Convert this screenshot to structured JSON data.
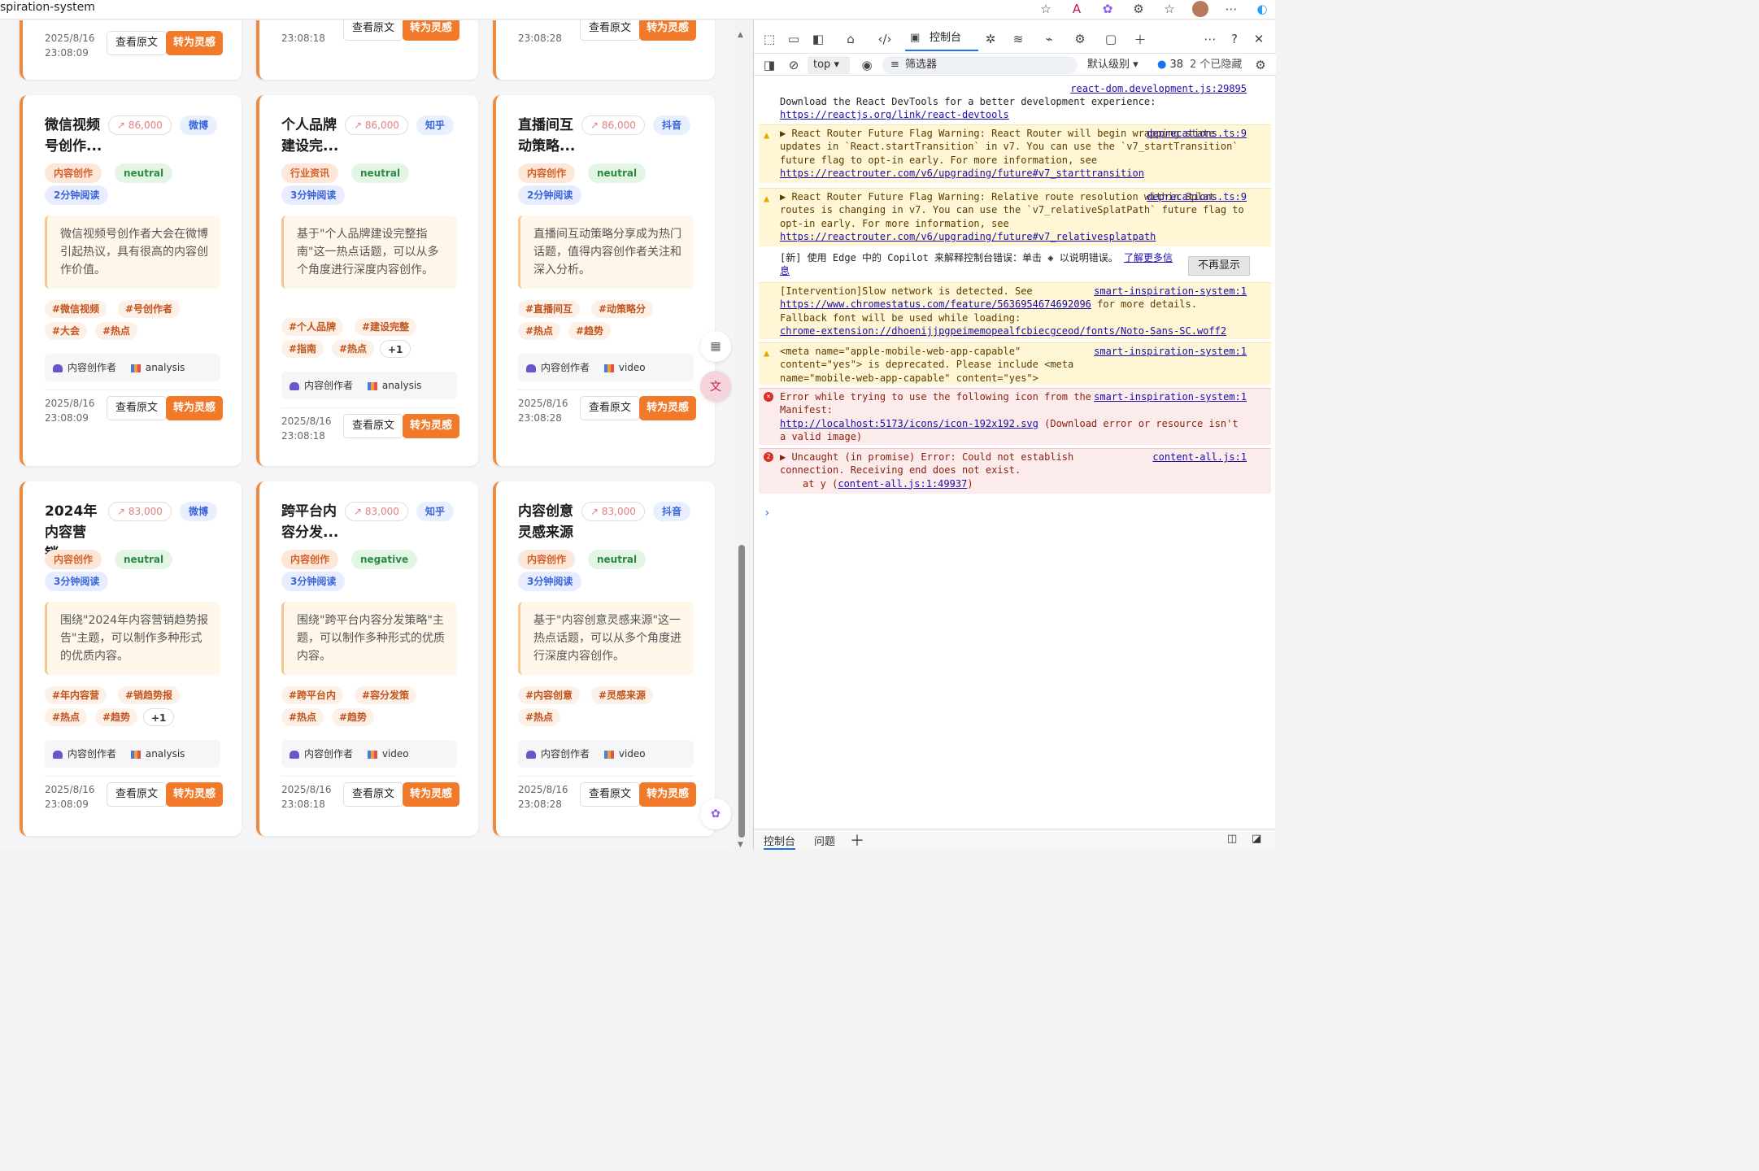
{
  "browser": {
    "url": "spiration-system"
  },
  "cards": [
    {
      "title": "",
      "trend": "",
      "platform": "",
      "category": "",
      "sentiment": "",
      "read": "",
      "summary": "",
      "tags": [],
      "more": "",
      "audience": "",
      "type": "",
      "date": "2025/8/16",
      "time": "23:08:09",
      "view": "查看原文",
      "inspire": "转为灵感"
    },
    {
      "title": "",
      "trend": "",
      "platform": "",
      "category": "",
      "sentiment": "",
      "read": "",
      "summary": "",
      "tags": [],
      "more": "",
      "audience": "",
      "type": "",
      "date": "",
      "time": "23:08:18",
      "view": "查看原文",
      "inspire": "转为灵感"
    },
    {
      "title": "",
      "trend": "",
      "platform": "",
      "category": "",
      "sentiment": "",
      "read": "",
      "summary": "",
      "tags": [],
      "more": "",
      "audience": "",
      "type": "",
      "date": "",
      "time": "23:08:28",
      "view": "查看原文",
      "inspire": "转为灵感"
    },
    {
      "title": "微信视频号创作...",
      "trend": "86,000",
      "platform": "微博",
      "category": "内容创作",
      "sentiment": "neutral",
      "read": "2分钟阅读",
      "summary": "微信视频号创作者大会在微博引起热议，具有很高的内容创作价值。",
      "tags": [
        "#微信视频",
        "#号创作者",
        "#大会",
        "#热点"
      ],
      "more": "",
      "audience": "内容创作者",
      "type": "analysis",
      "date": "2025/8/16",
      "time": "23:08:09",
      "view": "查看原文",
      "inspire": "转为灵感"
    },
    {
      "title": "个人品牌建设完...",
      "trend": "86,000",
      "platform": "知乎",
      "category": "行业资讯",
      "sentiment": "neutral",
      "read": "3分钟阅读",
      "summary": "基于\"个人品牌建设完整指南\"这一热点话题，可以从多个角度进行深度内容创作。",
      "tags": [
        "#个人品牌",
        "#建设完整",
        "#指南",
        "#热点"
      ],
      "more": "+1",
      "audience": "内容创作者",
      "type": "analysis",
      "date": "2025/8/16",
      "time": "23:08:18",
      "view": "查看原文",
      "inspire": "转为灵感"
    },
    {
      "title": "直播间互动策略...",
      "trend": "86,000",
      "platform": "抖音",
      "category": "内容创作",
      "sentiment": "neutral",
      "read": "2分钟阅读",
      "summary": "直播间互动策略分享成为热门话题，值得内容创作者关注和深入分析。",
      "tags": [
        "#直播间互",
        "#动策略分",
        "#热点",
        "#趋势"
      ],
      "more": "",
      "audience": "内容创作者",
      "type": "video",
      "date": "2025/8/16",
      "time": "23:08:28",
      "view": "查看原文",
      "inspire": "转为灵感"
    },
    {
      "title": "2024年内容营销...",
      "trend": "83,000",
      "platform": "微博",
      "category": "内容创作",
      "sentiment": "neutral",
      "read": "3分钟阅读",
      "summary": "围绕\"2024年内容营销趋势报告\"主题，可以制作多种形式的优质内容。",
      "tags": [
        "#年内容营",
        "#销趋势报",
        "#热点",
        "#趋势"
      ],
      "more": "+1",
      "audience": "内容创作者",
      "type": "analysis",
      "date": "2025/8/16",
      "time": "23:08:09",
      "view": "查看原文",
      "inspire": "转为灵感"
    },
    {
      "title": "跨平台内容分发...",
      "trend": "83,000",
      "platform": "知乎",
      "category": "内容创作",
      "sentiment": "negative",
      "read": "3分钟阅读",
      "summary": "围绕\"跨平台内容分发策略\"主题，可以制作多种形式的优质内容。",
      "tags": [
        "#跨平台内",
        "#容分发策",
        "#热点",
        "#趋势"
      ],
      "more": "",
      "audience": "内容创作者",
      "type": "video",
      "date": "2025/8/16",
      "time": "23:08:18",
      "view": "查看原文",
      "inspire": "转为灵感"
    },
    {
      "title": "内容创意灵感来源",
      "trend": "83,000",
      "platform": "抖音",
      "category": "内容创作",
      "sentiment": "neutral",
      "read": "3分钟阅读",
      "summary": "基于\"内容创意灵感来源\"这一热点话题，可以从多个角度进行深度内容创作。",
      "tags": [
        "#内容创意",
        "#灵感来源",
        "#热点"
      ],
      "more": "",
      "audience": "内容创作者",
      "type": "video",
      "date": "2025/8/16",
      "time": "23:08:28",
      "view": "查看原文",
      "inspire": "转为灵感"
    }
  ],
  "devtools": {
    "console_tab": "控制台",
    "context": "top",
    "filter_placeholder": "筛选器",
    "level": "默认级别",
    "count": "38",
    "hidden": "2 个已隐藏",
    "messages": {
      "react_src": "react-dom.development.js:29895",
      "react_text": "Download the React DevTools for a better development experience:",
      "react_link": "https://reactjs.org/link/react-devtools",
      "w1_src": "deprecations.ts:9",
      "w1_text": "React Router Future Flag Warning: React Router will begin wrapping state updates in `React.startTransition` in v7. You can use the `v7_startTransition` future flag to opt-in early. For more information, see",
      "w1_link": "https://reactrouter.com/v6/upgrading/future#v7_starttransition",
      "w2_src": "deprecations.ts:9",
      "w2_text": "React Router Future Flag Warning: Relative route resolution within Splat routes is changing in v7. You can use the `v7_relativeSplatPath` future flag to opt-in early. For more information, see",
      "w2_link": "https://reactrouter.com/v6/upgrading/future#v7_relativesplatpath",
      "copilot_text_a": "[新] 使用 Edge 中的 Copilot 来解释控制台错误：单击",
      "copilot_text_b": "以说明错误。",
      "copilot_link": "了解更多信息",
      "dismiss": "不再显示",
      "i1_src": "smart-inspiration-system:1",
      "i1_text_a": "[Intervention]Slow network is detected. See",
      "i1_link": "https://www.chromestatus.com/feature/5636954674692096",
      "i1_text_b": "for more details. Fallback font will be used while loading:",
      "i1_link2": "chrome-extension://dhoenijjpgpeimemopealfcbiecgceod/fonts/Noto-Sans-SC.woff2",
      "w3_src": "smart-inspiration-system:1",
      "w3_text": "<meta name=\"apple-mobile-web-app-capable\" content=\"yes\"> is deprecated. Please include <meta name=\"mobile-web-app-capable\" content=\"yes\">",
      "e1_src": "smart-inspiration-system:1",
      "e1_text_a": "Error while trying to use the following icon from the Manifest:",
      "e1_link": "http://localhost:5173/icons/icon-192x192.svg",
      "e1_text_b": "(Download error or resource isn't a valid image)",
      "e2_src": "content-all.js:1",
      "e2_count": "2",
      "e2_text": "Uncaught (in promise) Error: Could not establish connection. Receiving end does not exist.",
      "e2_at": "at y (",
      "e2_at_link": "content-all.js:1:49937",
      "e2_at_end": ")"
    },
    "bottom_tabs": [
      "控制台",
      "问题"
    ]
  }
}
